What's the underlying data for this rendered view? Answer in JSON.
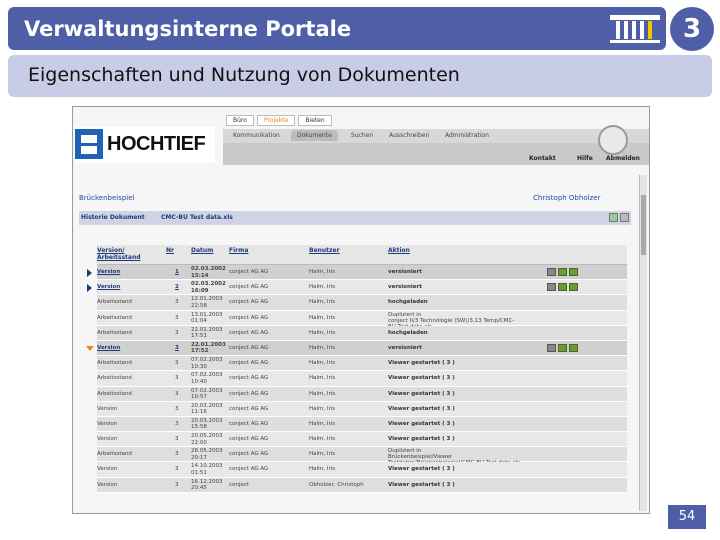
{
  "slide": {
    "title": "Verwaltungsinterne Portale",
    "section_number": "3",
    "subtitle": "Eigenschaften und Nutzung von Dokumenten",
    "page_number": "54",
    "accent_color": "#4e5fa8"
  },
  "screenshot": {
    "logo_text": "HOCHTIEF",
    "top_nav": [
      "Büro",
      "Projekte",
      "Bieten"
    ],
    "tabs": [
      "Kommunikation",
      "Dokumente",
      "Suchen",
      "Ausschreiben",
      "Administration"
    ],
    "util_links": [
      "Kontakt",
      "Hilfe",
      "Abmelden"
    ],
    "breadcrumb": "Brückenbeispiel",
    "user_name": "Christoph Obholzer",
    "history_label": "Historie Dokument",
    "document_name": "CMC-BU Test data.xls",
    "columns": [
      "Version/ Arbeitsstand",
      "Nr",
      "Datum",
      "Firma",
      "Benutzer",
      "Aktion"
    ],
    "rows": [
      {
        "type": "Version",
        "nr": "1",
        "date": "02.03.2002",
        "time": "15:14",
        "firm": "conject AG AG",
        "user": "Halm, Iris",
        "action": "versioniert",
        "marker": "right",
        "style": "ver",
        "icons": true
      },
      {
        "type": "Version",
        "nr": "2",
        "date": "02.03.2002",
        "time": "16:09",
        "firm": "conject AG AG",
        "user": "Halm, Iris",
        "action": "versioniert",
        "marker": "right",
        "style": "plain",
        "icons": true
      },
      {
        "type": "Arbeitsstand",
        "nr": "3",
        "date": "12.01.2003",
        "time": "22:58",
        "firm": "conject AG AG",
        "user": "Halm, Iris",
        "action": "hochgeladen",
        "style": "alt"
      },
      {
        "type": "Arbeitsstand",
        "nr": "3",
        "date": "13.01.2003",
        "time": "01:04",
        "firm": "conject AG AG",
        "user": "Halm, Iris",
        "action": "Dupliziert in",
        "action2": "conject II/3 Technologie (SW)/3.13 Temp/CMC-",
        "action3": "BU Test data.xls",
        "style": "plain"
      },
      {
        "type": "Arbeitsstand",
        "nr": "3",
        "date": "22.01.2003",
        "time": "17:51",
        "firm": "conject AG AG",
        "user": "Halm, Iris",
        "action": "hochgeladen",
        "style": "alt"
      },
      {
        "type": "Version",
        "nr": "3",
        "date": "22.01.2003",
        "time": "17:52",
        "firm": "conject AG AG",
        "user": "Halm, Iris",
        "action": "versioniert",
        "marker": "down",
        "style": "ver",
        "icons": true
      },
      {
        "type": "Arbeitsstand",
        "nr": "3",
        "date": "07.02.2003",
        "time": "10:30",
        "firm": "conject AG AG",
        "user": "Halm, Iris",
        "action": "Viewer gestartet ( 3 )",
        "style": "alt"
      },
      {
        "type": "Arbeitsstand",
        "nr": "3",
        "date": "07.02.2003",
        "time": "10:40",
        "firm": "conject AG AG",
        "user": "Halm, Iris",
        "action": "Viewer gestartet ( 3 )",
        "style": "plain"
      },
      {
        "type": "Arbeitsstand",
        "nr": "3",
        "date": "07.02.2003",
        "time": "10:57",
        "firm": "conject AG AG",
        "user": "Halm, Iris",
        "action": "Viewer gestartet ( 3 )",
        "style": "alt"
      },
      {
        "type": "Version",
        "nr": "3",
        "date": "20.03.2003",
        "time": "11:16",
        "firm": "conject AG AG",
        "user": "Halm, Iris",
        "action": "Viewer gestartet ( 3 )",
        "style": "plain"
      },
      {
        "type": "Version",
        "nr": "3",
        "date": "20.03.2003",
        "time": "15:58",
        "firm": "conject AG AG",
        "user": "Halm, Iris",
        "action": "Viewer gestartet ( 3 )",
        "style": "alt"
      },
      {
        "type": "Version",
        "nr": "3",
        "date": "20.05.2003",
        "time": "22:00",
        "firm": "conject AG AG",
        "user": "Halm, Iris",
        "action": "Viewer gestartet ( 3 )",
        "style": "plain"
      },
      {
        "type": "Arbeitsstand",
        "nr": "3",
        "date": "28.05.2003",
        "time": "20:17",
        "firm": "conject AG AG",
        "user": "Halm, Iris",
        "action": "Dupliziert in",
        "action2": "Brückenbeispiel/Viewer",
        "action3": "Testdaten/Brückenbeispiel/CMC-BU Test data.xls",
        "style": "alt"
      },
      {
        "type": "Version",
        "nr": "3",
        "date": "14.10.2003",
        "time": "01:51",
        "firm": "conject AG AG",
        "user": "Halm, Iris",
        "action": "Viewer gestartet ( 3 )",
        "style": "plain"
      },
      {
        "type": "Version",
        "nr": "3",
        "date": "16.12.2003",
        "time": "20:45",
        "firm": "conject",
        "user": "Obholzer, Christoph",
        "action": "Viewer gestartet ( 3 )",
        "style": "alt"
      }
    ]
  }
}
